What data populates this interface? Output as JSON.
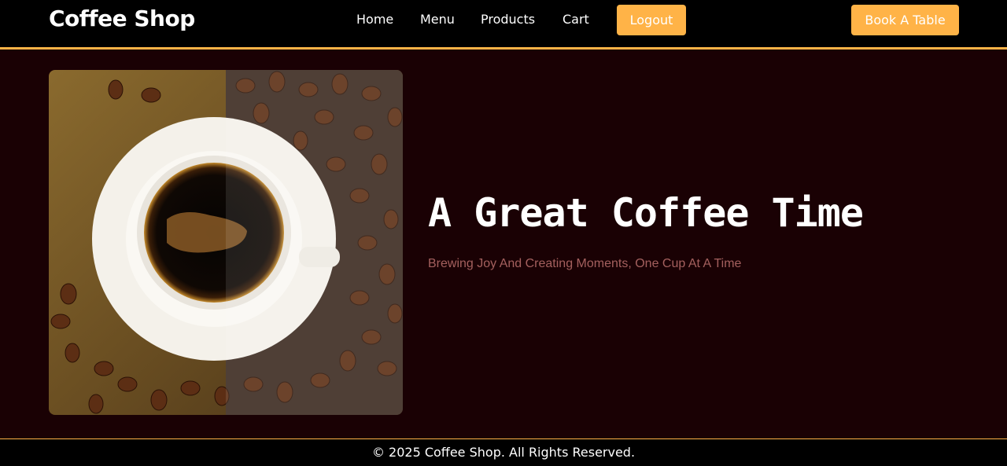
{
  "brand": "Coffee Shop",
  "nav": {
    "home": "Home",
    "menu": "Menu",
    "products": "Products",
    "cart": "Cart",
    "logout": "Logout",
    "book": "Book A Table"
  },
  "hero": {
    "title": "A Great Coffee Time",
    "subtitle": "Brewing Joy And Creating Moments, One Cup At A Time"
  },
  "footer": {
    "copyright": "© 2025 Coffee Shop. All Rights Reserved."
  },
  "colors": {
    "accent": "#ffb347",
    "background": "#1a0104",
    "navbar": "#000000",
    "subtitle": "#a4605e"
  }
}
